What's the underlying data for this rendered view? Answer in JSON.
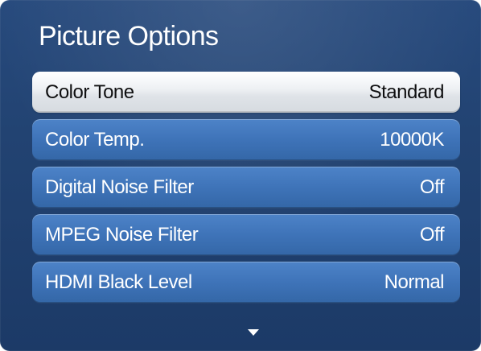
{
  "dialog": {
    "title": "Picture Options",
    "accent_color": "#2b4f84",
    "selected_color": "#e8ebee",
    "items": [
      {
        "label": "Color Tone",
        "value": "Standard",
        "selected": true
      },
      {
        "label": "Color Temp.",
        "value": "10000K",
        "selected": false
      },
      {
        "label": "Digital Noise Filter",
        "value": "Off",
        "selected": false
      },
      {
        "label": "MPEG Noise Filter",
        "value": "Off",
        "selected": false
      },
      {
        "label": "HDMI Black Level",
        "value": "Normal",
        "selected": false
      }
    ],
    "scroll_indicator_icon": "down-arrow-icon"
  }
}
